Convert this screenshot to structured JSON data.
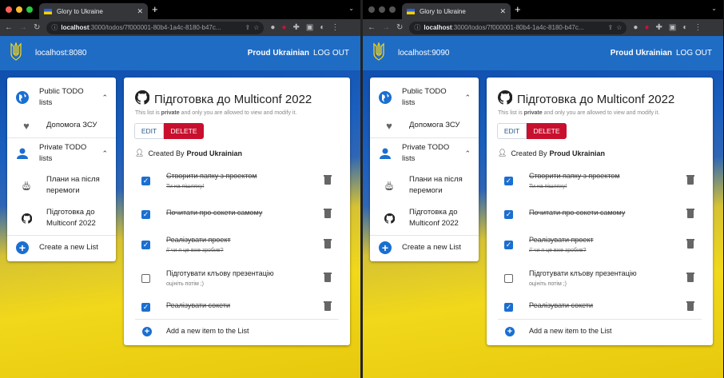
{
  "windows": [
    {
      "tab_title": "Glory to Ukraine",
      "url_host": "localhost",
      "url_rest": ":3000/todos/7f000001-80b4-1a4c-8180-b47c...",
      "app_host": "localhost:8080",
      "user": "Proud Ukrainian",
      "logout": "LOG OUT",
      "sidebar": {
        "public_header": "Public TODO lists",
        "public_items": [
          "Допомога ЗСУ"
        ],
        "private_header": "Private TODO lists",
        "private_items": [
          "Плани на після перемоги",
          "Підготовка до Multiconf 2022"
        ],
        "create": "Create a new List"
      },
      "list": {
        "title": "Підготовка до Multiconf 2022",
        "note_pre": "This list is ",
        "note_bold": "private",
        "note_post": " and only you are allowed to view and modify it.",
        "edit": "EDIT",
        "delete": "DELETE",
        "created_by_label": "Created By",
        "created_by": "Proud Ukrainian",
        "items": [
          {
            "title": "Створити папку з проектом",
            "sub": "Ти на пішляху!",
            "done": true
          },
          {
            "title": "Почитати про сокети самому",
            "sub": "",
            "done": true
          },
          {
            "title": "Реалізувати проект",
            "sub": "// чи я це вже зробив?",
            "done": true
          },
          {
            "title": "Підготувати клъову презентацію",
            "sub": "оцініть потім ;)",
            "done": false
          },
          {
            "title": "Реалізувати сокети",
            "sub": "",
            "done": true
          }
        ],
        "add": "Add a new item to the List"
      }
    },
    {
      "tab_title": "Glory to Ukraine",
      "url_host": "localhost",
      "url_rest": ":3000/todos/7f000001-80b4-1a4c-8180-b47c...",
      "app_host": "localhost:9090",
      "user": "Proud Ukrainian",
      "logout": "LOG OUT",
      "sidebar": {
        "public_header": "Public TODO lists",
        "public_items": [
          "Допомога ЗСУ"
        ],
        "private_header": "Private TODO lists",
        "private_items": [
          "Плани на після перемоги",
          "Підготовка до Multiconf 2022"
        ],
        "create": "Create a new List"
      },
      "list": {
        "title": "Підготовка до Multiconf 2022",
        "note_pre": "This list is ",
        "note_bold": "private",
        "note_post": " and only you are allowed to view and modify it.",
        "edit": "EDIT",
        "delete": "DELETE",
        "created_by_label": "Created By",
        "created_by": "Proud Ukrainian",
        "items": [
          {
            "title": "Створити папку з проектом",
            "sub": "Ти на пішляху!",
            "done": true
          },
          {
            "title": "Почитати про сокети самому",
            "sub": "",
            "done": true
          },
          {
            "title": "Реалізувати проект",
            "sub": "// чи я це вже зробив?",
            "done": true
          },
          {
            "title": "Підготувати клъову презентацію",
            "sub": "оцініть потім ;)",
            "done": false
          },
          {
            "title": "Реалізувати сокети",
            "sub": "",
            "done": true
          }
        ],
        "add": "Add a new item to the List"
      }
    }
  ]
}
